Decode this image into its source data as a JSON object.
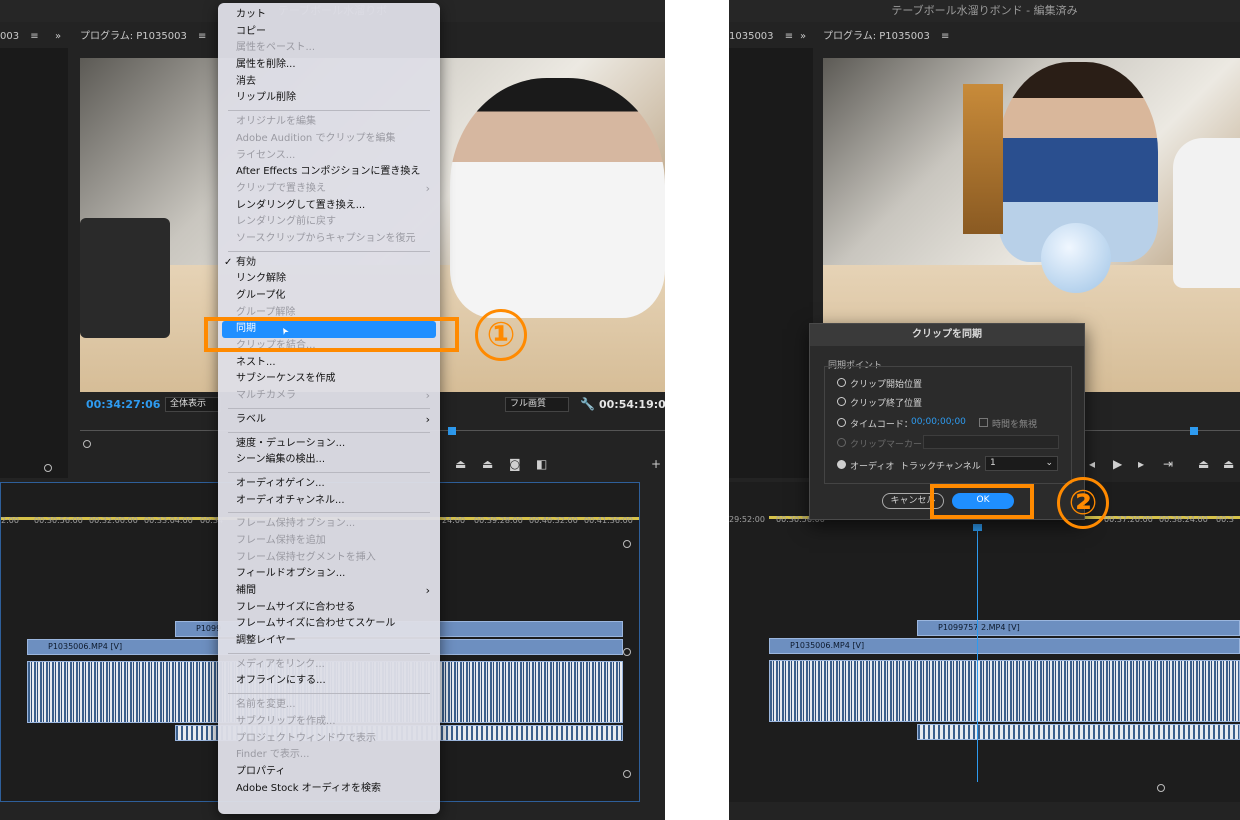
{
  "left": {
    "title": "テーブボール水溜りボ",
    "tab_left": "003",
    "program_label": "プログラム: P1035003",
    "tc_current": "00:34:27:06",
    "zoom_select": "全体表示",
    "quality_select": "フル画質",
    "tc_total": "00:54:19:06",
    "ruler": [
      "2:00",
      "00:30:56:00",
      "00:32:00:00",
      "00:33:04:00",
      "00:34",
      "24:00",
      "00:39:28:00",
      "00:40:32:00",
      "00:41:36:00"
    ],
    "clip_v2": "P1099",
    "clip_v1": "P1035006.MP4 [V]"
  },
  "context_menu": {
    "items": [
      {
        "label": "カット",
        "enabled": true
      },
      {
        "label": "コピー",
        "enabled": true
      },
      {
        "label": "属性をペースト...",
        "enabled": false
      },
      {
        "label": "属性を削除...",
        "enabled": true
      },
      {
        "label": "消去",
        "enabled": true
      },
      {
        "label": "リップル削除",
        "enabled": true
      },
      {
        "sep": true
      },
      {
        "label": "オリジナルを編集",
        "enabled": false
      },
      {
        "label": "Adobe Audition でクリップを編集",
        "enabled": false
      },
      {
        "label": "ライセンス...",
        "enabled": false
      },
      {
        "label": "After Effects コンポジションに置き換え",
        "enabled": true
      },
      {
        "label": "クリップで置き換え",
        "enabled": false,
        "submenu": true
      },
      {
        "label": "レンダリングして置き換え...",
        "enabled": true
      },
      {
        "label": "レンダリング前に戻す",
        "enabled": false
      },
      {
        "label": "ソースクリップからキャプションを復元",
        "enabled": false
      },
      {
        "sep": true
      },
      {
        "label": "有効",
        "enabled": true,
        "checked": true
      },
      {
        "label": "リンク解除",
        "enabled": true
      },
      {
        "label": "グループ化",
        "enabled": true
      },
      {
        "label": "グループ解除",
        "enabled": false
      },
      {
        "label": "同期",
        "enabled": true,
        "highlight": true
      },
      {
        "label": "クリップを結合...",
        "enabled": false
      },
      {
        "label": "ネスト...",
        "enabled": true
      },
      {
        "label": "サブシーケンスを作成",
        "enabled": true
      },
      {
        "label": "マルチカメラ",
        "enabled": false,
        "submenu": true
      },
      {
        "sep": true
      },
      {
        "label": "ラベル",
        "enabled": true,
        "submenu": true
      },
      {
        "sep": true
      },
      {
        "label": "速度・デュレーション...",
        "enabled": true
      },
      {
        "label": "シーン編集の検出...",
        "enabled": true
      },
      {
        "sep": true
      },
      {
        "label": "オーディオゲイン...",
        "enabled": true
      },
      {
        "label": "オーディオチャンネル...",
        "enabled": true
      },
      {
        "sep": true
      },
      {
        "label": "フレーム保持オプション...",
        "enabled": false
      },
      {
        "label": "フレーム保持を追加",
        "enabled": false
      },
      {
        "label": "フレーム保持セグメントを挿入",
        "enabled": false
      },
      {
        "label": "フィールドオプション...",
        "enabled": true
      },
      {
        "label": "補間",
        "enabled": true,
        "submenu": true
      },
      {
        "label": "フレームサイズに合わせる",
        "enabled": true
      },
      {
        "label": "フレームサイズに合わせてスケール",
        "enabled": true
      },
      {
        "label": "調整レイヤー",
        "enabled": true
      },
      {
        "sep": true
      },
      {
        "label": "メディアをリンク...",
        "enabled": false
      },
      {
        "label": "オフラインにする...",
        "enabled": true
      },
      {
        "sep": true
      },
      {
        "label": "名前を変更...",
        "enabled": false
      },
      {
        "label": "サブクリップを作成...",
        "enabled": false
      },
      {
        "label": "プロジェクトウィンドウで表示",
        "enabled": false
      },
      {
        "label": "Finder で表示...",
        "enabled": false
      },
      {
        "label": "プロパティ",
        "enabled": true
      },
      {
        "label": "Adobe Stock オーディオを検索",
        "enabled": true
      }
    ]
  },
  "step1": "①",
  "step2": "②",
  "right": {
    "title": "テーブボール水溜りボンド - 編集済み",
    "tab_left": "1035003",
    "program_label": "プログラム: P1035003",
    "ruler": [
      "29:52:00",
      "00:30:56:00",
      "00:37:20:00",
      "00:38:24:00",
      "00:3"
    ],
    "clip_v2": "P1099757 2.MP4 [V]",
    "clip_v1": "P1035006.MP4 [V]"
  },
  "dialog": {
    "title": "クリップを同期",
    "section": "同期ポイント",
    "opt_start": "クリップ開始位置",
    "opt_end": "クリップ終了位置",
    "opt_timecode": "タイムコード：",
    "timecode_value": "00;00;00;00",
    "ignore_hours": "時間を無視",
    "opt_marker": "クリップマーカー",
    "opt_audio": "オーディオ",
    "track_channel_label": "トラックチャンネル",
    "track_channel_value": "1",
    "cancel": "キャンセル",
    "ok": "OK"
  },
  "colors": {
    "accent_orange": "#ff8a00",
    "accent_blue": "#2e9bf0",
    "highlight": "#1f8fff"
  }
}
